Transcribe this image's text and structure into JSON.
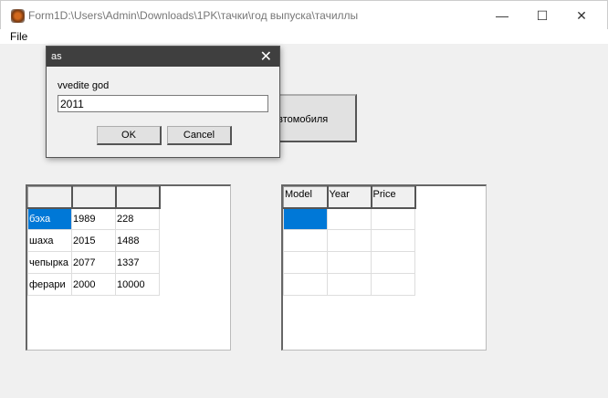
{
  "window": {
    "title": "Form1D:\\Users\\Admin\\Downloads\\1PK\\тачки\\год выпуска\\тачиллы",
    "minimize": "—",
    "maximize": "☐",
    "close": "✕"
  },
  "menu": {
    "file": "File"
  },
  "main_button": {
    "label": "автомобиля"
  },
  "left_grid": {
    "headers": [
      "",
      "",
      ""
    ],
    "rows": [
      [
        "бэха",
        "1989",
        "228"
      ],
      [
        "шаха",
        "2015",
        "1488"
      ],
      [
        "чепырка",
        "2077",
        "1337"
      ],
      [
        "ферари",
        "2000",
        "10000"
      ]
    ]
  },
  "right_grid": {
    "headers": [
      "Model",
      "Year",
      "Price"
    ],
    "rows": [
      [
        "",
        "",
        ""
      ],
      [
        "",
        "",
        ""
      ],
      [
        "",
        "",
        ""
      ],
      [
        "",
        "",
        ""
      ]
    ]
  },
  "dialog": {
    "title": "as",
    "close": "✕",
    "prompt": "vvedite god",
    "value": "2011",
    "ok": "OK",
    "cancel": "Cancel"
  }
}
